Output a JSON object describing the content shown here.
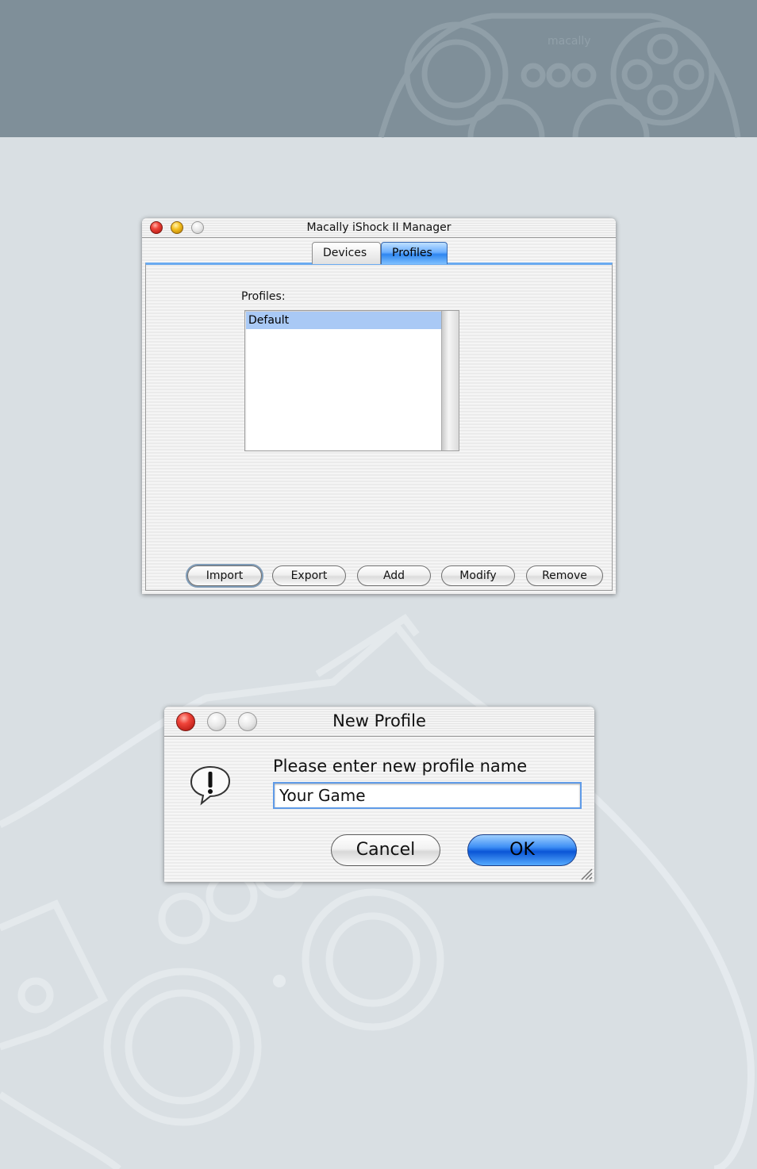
{
  "main_window": {
    "title": "Macally iShock II Manager",
    "tabs": [
      {
        "label": "Devices",
        "active": false
      },
      {
        "label": "Profiles",
        "active": true
      }
    ],
    "profiles_label": "Profiles:",
    "profiles_list": [
      "Default"
    ],
    "selected_profile": "Default",
    "buttons": {
      "import": "Import",
      "export": "Export",
      "add": "Add",
      "modify": "Modify",
      "remove": "Remove"
    }
  },
  "dialog": {
    "title": "New Profile",
    "prompt": "Please enter new profile name",
    "input_value": "Your Game",
    "cancel_label": "Cancel",
    "ok_label": "OK",
    "icon": "alert-icon"
  },
  "background": {
    "logo_text": "macally",
    "header_color": "#7f8f99",
    "page_color": "#d9dfe3",
    "accent_color": "#3d8ef5"
  }
}
